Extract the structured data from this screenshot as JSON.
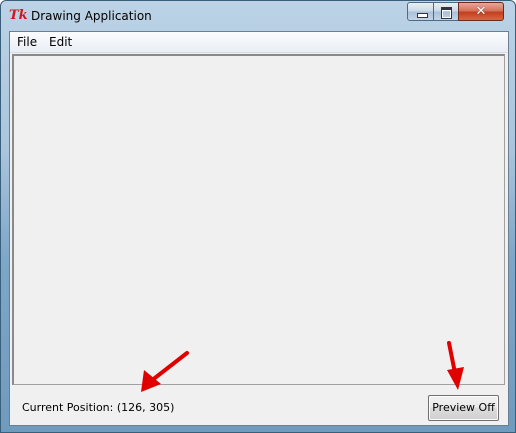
{
  "window": {
    "title": "Drawing Application",
    "close_glyph": "✕"
  },
  "menubar": {
    "file_label": "File",
    "edit_label": "Edit"
  },
  "status": {
    "position_text": "Current Position: (126, 305)"
  },
  "preview_button": {
    "label": "Preview Off"
  },
  "colors": {
    "annotation_arrow": "#e00000",
    "title_icon": "#d4141a"
  },
  "icons": {
    "app_icon": "tk-feather-icon",
    "app_icon_glyph": "Tk"
  }
}
